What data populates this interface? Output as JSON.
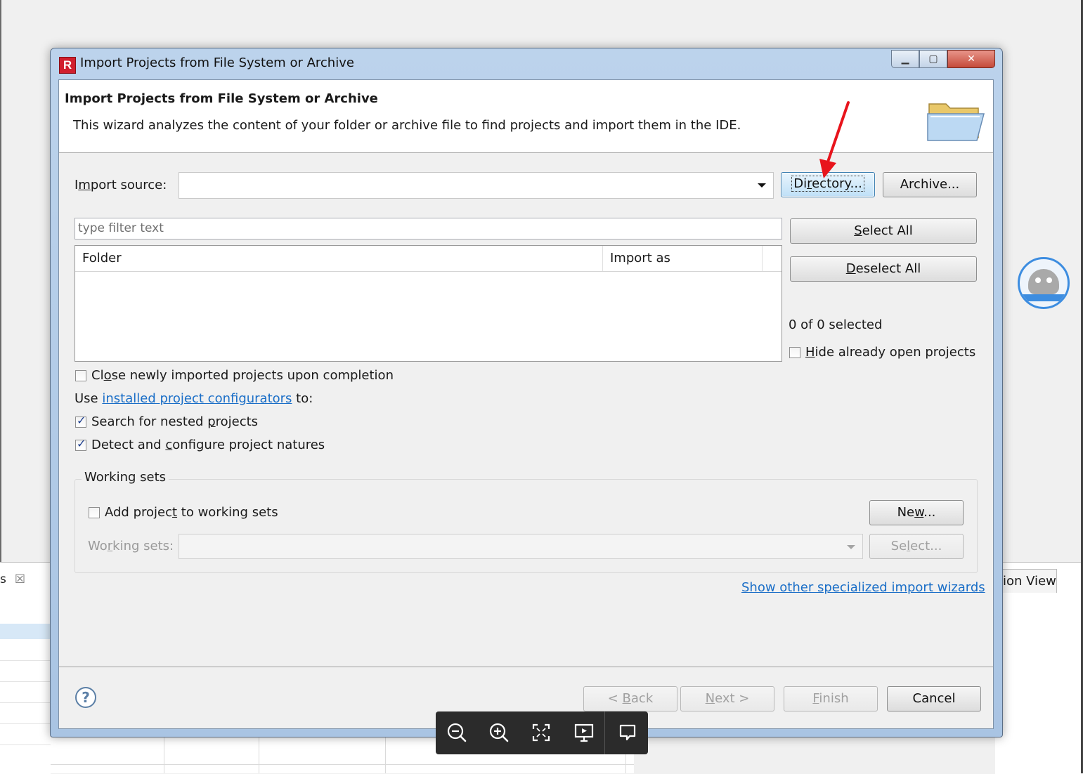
{
  "dialog": {
    "title": "Import Projects from File System or Archive",
    "app_icon_letter": "R",
    "window_buttons": {
      "minimize": "▁",
      "maximize": "▢",
      "close": "✕"
    }
  },
  "banner": {
    "title": "Import Projects from File System or Archive",
    "description": "This wizard analyzes the content of your folder or archive file to find projects and import them in the IDE."
  },
  "import_source": {
    "label_prefix": "I",
    "label_mnemonic": "m",
    "label_rest": "port source:",
    "value": "",
    "directory_prefix": "Di",
    "directory_mnemonic": "r",
    "directory_rest": "ectory...",
    "archive_label": "Archive..."
  },
  "filter": {
    "placeholder": "type filter text"
  },
  "table": {
    "columns": [
      "Folder",
      "Import as"
    ],
    "rows": []
  },
  "selection": {
    "select_all_mnemonic": "S",
    "select_all_rest": "elect All",
    "deselect_all_mnemonic": "D",
    "deselect_all_rest": "eselect All",
    "status": "0 of 0 selected",
    "hide_open_mnemonic": "H",
    "hide_open_rest": "ide already open projects",
    "hide_open_checked": false
  },
  "options": {
    "close_projects": {
      "pre": "Cl",
      "mn": "o",
      "post": "se newly imported projects upon completion",
      "checked": false
    },
    "use_prefix": "Use",
    "configurators_link": "installed project configurators",
    "use_suffix": "to:",
    "nested": {
      "pre": "Search for nested ",
      "mn": "p",
      "post": "rojects",
      "checked": true
    },
    "natures": {
      "pre": "Detect and ",
      "mn": "c",
      "post": "onfigure project natures",
      "checked": true
    }
  },
  "working_sets": {
    "legend": "Working sets",
    "add": {
      "pre": "Add projec",
      "mn": "t",
      "post": " to working sets",
      "checked": false
    },
    "new_pre": "Ne",
    "new_mn": "w",
    "new_post": "...",
    "label_pre": "Wo",
    "label_mn": "r",
    "label_post": "king sets:",
    "select_pre": "Se",
    "select_mn": "l",
    "select_post": "ect...",
    "value": ""
  },
  "other_wizards_link": "Show other specialized import wizards",
  "footer": {
    "help": "?",
    "back_pre": "< ",
    "back_mn": "B",
    "back_post": "ack",
    "next_mn": "N",
    "next_post": "ext >",
    "finish_mn": "F",
    "finish_post": "inish",
    "cancel": "Cancel"
  },
  "background": {
    "left_tab": "s",
    "left_tab_close": "☒",
    "right_tab": "ion View"
  },
  "viewer_toolbar": [
    "zoom-out-icon",
    "zoom-in-icon",
    "fit-screen-icon",
    "slideshow-icon",
    "comment-icon"
  ],
  "colors": {
    "link": "#1a6ec7",
    "focus_button": "#bfe0f7",
    "annotation_arrow": "#e8141c"
  }
}
